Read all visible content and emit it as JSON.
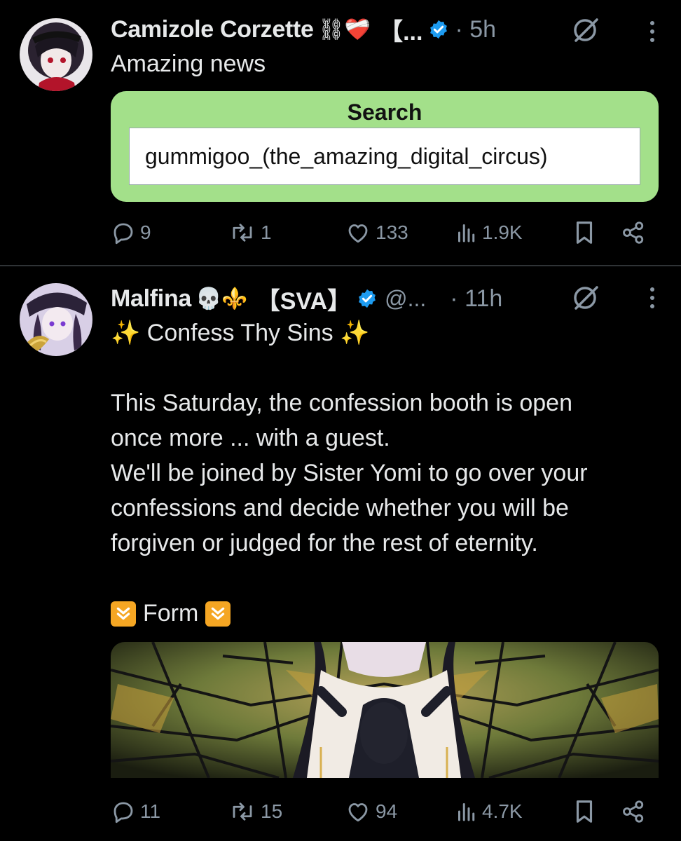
{
  "tweets": [
    {
      "author": "Camizole Corzette",
      "name_emojis": "⛓❤️‍🩹",
      "bracket_tag": "【...",
      "time": "· 5h",
      "text": "Amazing news",
      "search_card": {
        "title": "Search",
        "query": "gummigoo_(the_amazing_digital_circus)"
      },
      "stats": {
        "replies": "9",
        "reposts": "1",
        "likes": "133",
        "views": "1.9K"
      }
    },
    {
      "author": "Malfina",
      "name_emojis": "💀⚜️",
      "bracket_tag": "【SVA】",
      "handle": "@...",
      "time": "· 11h",
      "text": "✨ Confess Thy Sins ✨",
      "body": [
        "This Saturday, the confession booth is open",
        "once more ... with a guest.",
        "We'll be joined by Sister Yomi to go over your",
        "confessions and decide whether you will be",
        "forgiven or judged for the rest of eternity."
      ],
      "form_label": "Form",
      "stats": {
        "replies": "11",
        "reposts": "15",
        "likes": "94",
        "views": "4.7K"
      }
    }
  ],
  "colors": {
    "background": "#000000",
    "text": "#e7e9ea",
    "muted": "#8b98a5",
    "verified": "#1d9bf0",
    "search_card": "#a3e08a"
  },
  "icons": [
    "reply-icon",
    "repost-icon",
    "like-icon",
    "views-icon",
    "bookmark-icon",
    "share-icon",
    "grok-icon",
    "more-icon",
    "verified-icon"
  ]
}
